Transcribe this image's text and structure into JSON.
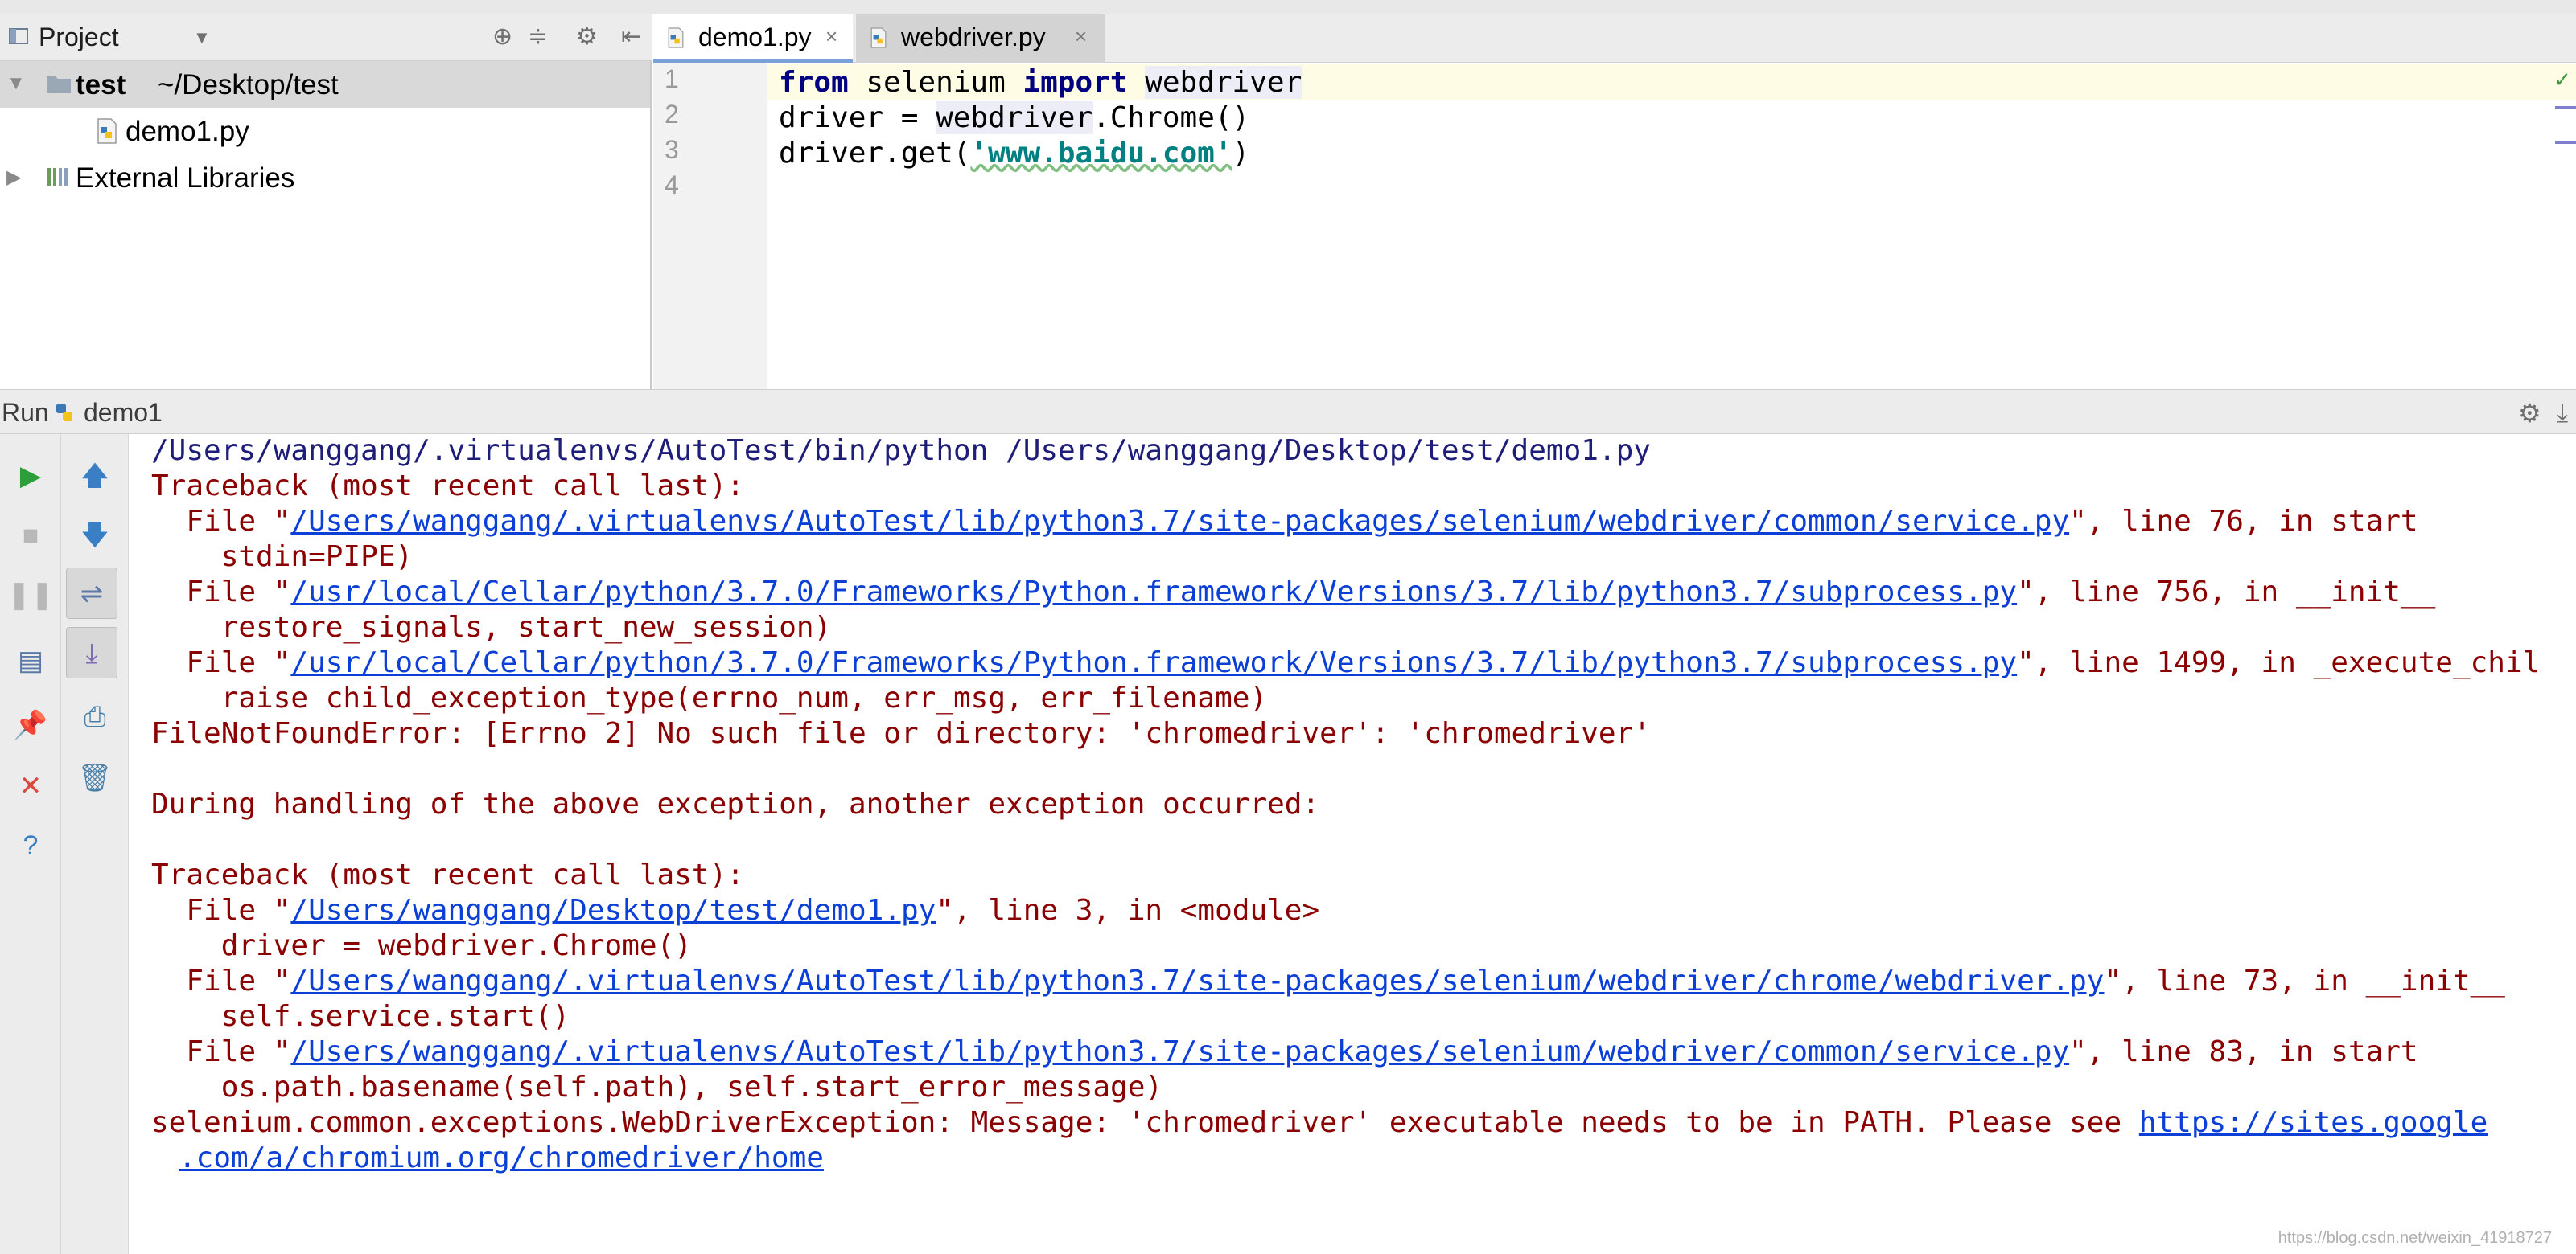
{
  "project_panel": {
    "title": "Project",
    "root_name": "test",
    "root_path": "~/Desktop/test",
    "file_name": "demo1.py",
    "external_libraries": "External Libraries"
  },
  "editor": {
    "tabs": [
      {
        "label": "demo1.py",
        "close": "×"
      },
      {
        "label": "webdriver.py",
        "close": "×"
      }
    ],
    "line_numbers": [
      "1",
      "2",
      "3",
      "4"
    ],
    "code": {
      "l1_from": "from",
      "l1_module": " selenium ",
      "l1_import": "import",
      "l1_sp": " ",
      "l1_name": "webdriver",
      "l2_pre": "driver = ",
      "l2_ident": "webdriver",
      "l2_post": ".Chrome()",
      "l3_pre": "driver.get(",
      "l3_str": "'www.baidu.com'",
      "l3_post": ")"
    }
  },
  "run_panel": {
    "label": "Run",
    "config": "demo1",
    "console": {
      "cmd": "/Users/wanggang/.virtualenvs/AutoTest/bin/python /Users/wanggang/Desktop/test/demo1.py",
      "tb1": "Traceback (most recent call last):",
      "f1_pre": "  File \"",
      "f1_path": "/Users/wanggang/.virtualenvs/AutoTest/lib/python3.7/site-packages/selenium/webdriver/common/service.py",
      "f1_post": "\", line 76, in start",
      "f1_code": "    stdin=PIPE)",
      "f2_pre": "  File \"",
      "f2_path": "/usr/local/Cellar/python/3.7.0/Frameworks/Python.framework/Versions/3.7/lib/python3.7/subprocess.py",
      "f2_post": "\", line 756, in __init__",
      "f2_code": "    restore_signals, start_new_session)",
      "f3_pre": "  File \"",
      "f3_path": "/usr/local/Cellar/python/3.7.0/Frameworks/Python.framework/Versions/3.7/lib/python3.7/subprocess.py",
      "f3_post": "\", line 1499, in _execute_chil",
      "f3_code": "    raise child_exception_type(errno_num, err_msg, err_filename)",
      "err1": "FileNotFoundError: [Errno 2] No such file or directory: 'chromedriver': 'chromedriver'",
      "during": "During handling of the above exception, another exception occurred:",
      "tb2": "Traceback (most recent call last):",
      "g1_pre": "  File \"",
      "g1_path": "/Users/wanggang/Desktop/test/demo1.py",
      "g1_post": "\", line 3, in <module>",
      "g1_code": "    driver = webdriver.Chrome()",
      "g2_pre": "  File \"",
      "g2_path": "/Users/wanggang/.virtualenvs/AutoTest/lib/python3.7/site-packages/selenium/webdriver/chrome/webdriver.py",
      "g2_post": "\", line 73, in __init__",
      "g2_code": "    self.service.start()",
      "g3_pre": "  File \"",
      "g3_path": "/Users/wanggang/.virtualenvs/AutoTest/lib/python3.7/site-packages/selenium/webdriver/common/service.py",
      "g3_post": "\", line 83, in start",
      "g3_code": "    os.path.basename(self.path), self.start_error_message)",
      "final_pre": "selenium.common.exceptions.WebDriverException: Message: 'chromedriver' executable needs to be in PATH. Please see ",
      "final_link1": "https://sites.google",
      "final_link2": ".com/a/chromium.org/chromedriver/home"
    }
  },
  "watermark": "https://blog.csdn.net/weixin_41918727",
  "colors": {
    "keyword": "#000080",
    "string": "#008080",
    "error_text": "#8b0000",
    "link": "#0b3fd6",
    "run_green": "#2e9e3a",
    "stop_red": "#d94a3d"
  }
}
